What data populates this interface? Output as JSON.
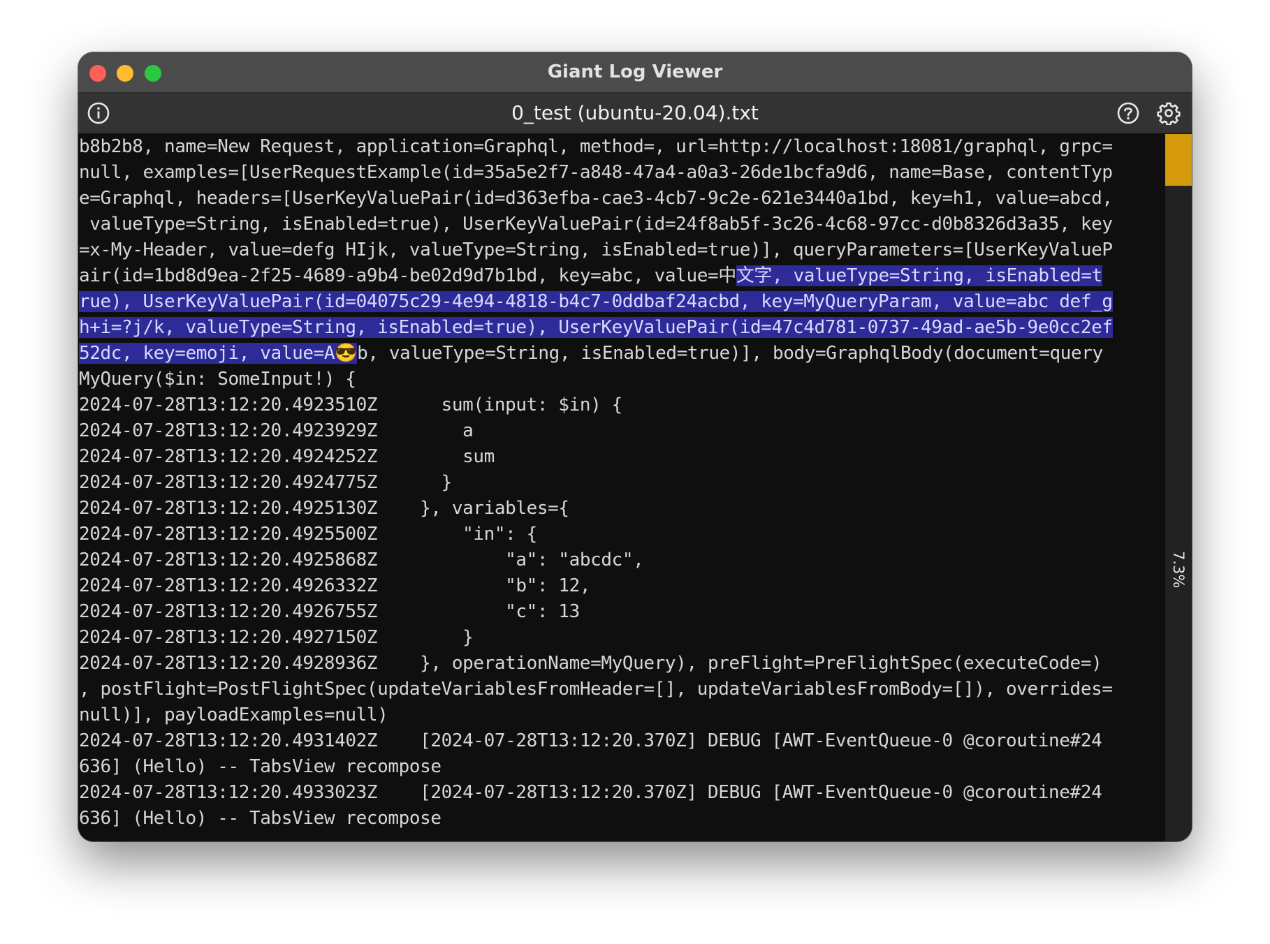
{
  "window": {
    "title": "Giant Log Viewer"
  },
  "toolbar": {
    "file_title": "0_test (ubuntu-20.04).txt",
    "info_icon": "info-icon",
    "help_icon": "help-icon",
    "settings_icon": "gear-icon"
  },
  "scrollbar": {
    "percent_label": "7.3%",
    "percent_value": 7.3,
    "thumb_color": "#d69a0d"
  },
  "colors": {
    "background": "#0f0f0f",
    "selection": "#2d2b97",
    "text": "#d6d6d6"
  },
  "log": {
    "lines": [
      {
        "pre": "b8b2b8, name=New Request, application=Graphql, method=, url=http://localhost:18081/graphql, grpc=",
        "sel": "",
        "post": ""
      },
      {
        "pre": "null, examples=[UserRequestExample(id=35a5e2f7-a848-47a4-a0a3-26de1bcfa9d6, name=Base, contentTyp",
        "sel": "",
        "post": ""
      },
      {
        "pre": "e=Graphql, headers=[UserKeyValuePair(id=d363efba-cae3-4cb7-9c2e-621e3440a1bd, key=h1, value=abcd,",
        "sel": "",
        "post": ""
      },
      {
        "pre": " valueType=String, isEnabled=true), UserKeyValuePair(id=24f8ab5f-3c26-4c68-97cc-d0b8326d3a35, key",
        "sel": "",
        "post": ""
      },
      {
        "pre": "=x-My-Header, value=defg HIjk, valueType=String, isEnabled=true)], queryParameters=[UserKeyValueP",
        "sel": "",
        "post": ""
      },
      {
        "pre": "air(id=1bd8d9ea-2f25-4689-a9b4-be02d9d7b1bd, key=abc, value=中",
        "sel": "文字, valueType=String, isEnabled=t",
        "post": ""
      },
      {
        "pre": "",
        "sel": "rue), UserKeyValuePair(id=04075c29-4e94-4818-b4c7-0ddbaf24acbd, key=MyQueryParam, value=abc def_g",
        "post": ""
      },
      {
        "pre": "",
        "sel": "h+i=?j/k, valueType=String, isEnabled=true), UserKeyValuePair(id=47c4d781-0737-49ad-ae5b-9e0cc2ef",
        "post": ""
      },
      {
        "pre": "",
        "sel": "52dc, key=emoji, value=A😎",
        "post": "b, valueType=String, isEnabled=true)], body=GraphqlBody(document=query"
      },
      {
        "pre": "MyQuery($in: SomeInput!) {",
        "sel": "",
        "post": ""
      },
      {
        "pre": "2024-07-28T13:12:20.4923510Z      sum(input: $in) {",
        "sel": "",
        "post": ""
      },
      {
        "pre": "2024-07-28T13:12:20.4923929Z        a",
        "sel": "",
        "post": ""
      },
      {
        "pre": "2024-07-28T13:12:20.4924252Z        sum",
        "sel": "",
        "post": ""
      },
      {
        "pre": "2024-07-28T13:12:20.4924775Z      }",
        "sel": "",
        "post": ""
      },
      {
        "pre": "2024-07-28T13:12:20.4925130Z    }, variables={",
        "sel": "",
        "post": ""
      },
      {
        "pre": "2024-07-28T13:12:20.4925500Z        \"in\": {",
        "sel": "",
        "post": ""
      },
      {
        "pre": "2024-07-28T13:12:20.4925868Z            \"a\": \"abcdc\",",
        "sel": "",
        "post": ""
      },
      {
        "pre": "2024-07-28T13:12:20.4926332Z            \"b\": 12,",
        "sel": "",
        "post": ""
      },
      {
        "pre": "2024-07-28T13:12:20.4926755Z            \"c\": 13",
        "sel": "",
        "post": ""
      },
      {
        "pre": "2024-07-28T13:12:20.4927150Z        }",
        "sel": "",
        "post": ""
      },
      {
        "pre": "2024-07-28T13:12:20.4928936Z    }, operationName=MyQuery), preFlight=PreFlightSpec(executeCode=)",
        "sel": "",
        "post": ""
      },
      {
        "pre": ", postFlight=PostFlightSpec(updateVariablesFromHeader=[], updateVariablesFromBody=[]), overrides=",
        "sel": "",
        "post": ""
      },
      {
        "pre": "null)], payloadExamples=null)",
        "sel": "",
        "post": ""
      },
      {
        "pre": "2024-07-28T13:12:20.4931402Z    [2024-07-28T13:12:20.370Z] DEBUG [AWT-EventQueue-0 @coroutine#24",
        "sel": "",
        "post": ""
      },
      {
        "pre": "636] (Hello) -- TabsView recompose",
        "sel": "",
        "post": ""
      },
      {
        "pre": "2024-07-28T13:12:20.4933023Z    [2024-07-28T13:12:20.370Z] DEBUG [AWT-EventQueue-0 @coroutine#24",
        "sel": "",
        "post": ""
      },
      {
        "pre": "636] (Hello) -- TabsView recompose",
        "sel": "",
        "post": ""
      }
    ]
  }
}
